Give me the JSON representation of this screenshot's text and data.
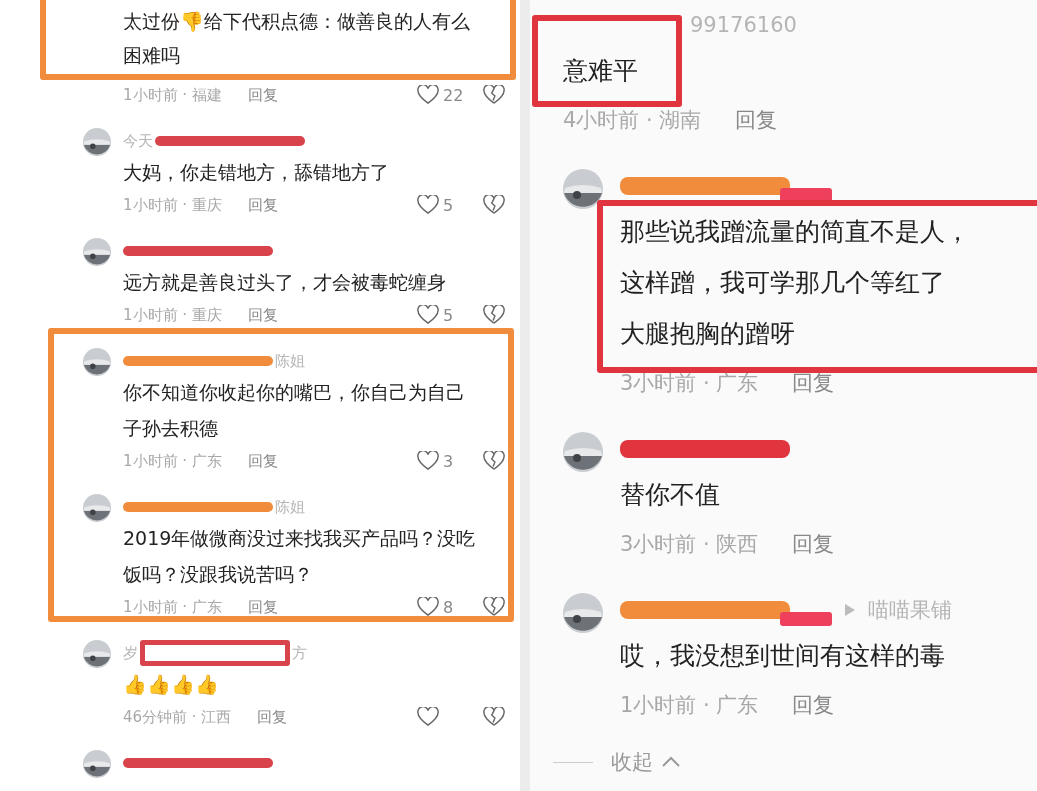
{
  "left": {
    "comments": [
      {
        "avatar": false,
        "lines": [
          "太过份👎给下代积点德：做善良的人有么",
          "困难吗"
        ],
        "time": "1小时前 · 福建",
        "reply": "回复",
        "likes": "22"
      },
      {
        "name_parts": [
          {
            "kind": "text",
            "text": "今天"
          },
          {
            "kind": "bar",
            "color": "#d9434c"
          }
        ],
        "avatar": true,
        "lines": [
          "大妈，你走错地方，舔错地方了"
        ],
        "time": "1小时前 · 重庆",
        "reply": "回复",
        "likes": "5"
      },
      {
        "name_parts": [
          {
            "kind": "bar",
            "color": "#d9434c"
          }
        ],
        "avatar": true,
        "lines": [
          "远方就是善良过头了，才会被毒蛇缠身"
        ],
        "time": "1小时前 · 重庆",
        "reply": "回复",
        "likes": "5"
      },
      {
        "name_parts": [
          {
            "kind": "bar",
            "color": "#f08c3c"
          },
          {
            "kind": "text",
            "text": "陈姐"
          }
        ],
        "avatar": true,
        "lines": [
          "你不知道你收起你的嘴巴，你自己为自己",
          "子孙去积德"
        ],
        "time": "1小时前 · 广东",
        "reply": "回复",
        "likes": "3"
      },
      {
        "name_parts": [
          {
            "kind": "bar",
            "color": "#f08c3c"
          },
          {
            "kind": "text",
            "text": "陈姐"
          }
        ],
        "avatar": true,
        "lines": [
          "2019年做微商没过来找我买产品吗？没吃",
          "饭吗？没跟我说苦吗？"
        ],
        "time": "1小时前 · 广东",
        "reply": "回复",
        "likes": "8"
      },
      {
        "name_parts": [
          {
            "kind": "text",
            "text": "岁"
          },
          {
            "kind": "outlined",
            "color": "#d9434c"
          },
          {
            "kind": "text",
            "text": "方"
          }
        ],
        "avatar": true,
        "lines": [
          "👍👍👍👍"
        ],
        "time": "46分钟前 · 江西",
        "reply": "回复"
      },
      {
        "name_parts": [
          {
            "kind": "bar",
            "color": "#d9434c"
          }
        ],
        "avatar": true
      }
    ],
    "annotations": [
      {
        "color": "#f08c3c"
      },
      {
        "color": "#f08c3c"
      }
    ]
  },
  "right": {
    "comments": [
      {
        "name_parts": [
          {
            "kind": "gap"
          },
          {
            "kind": "text",
            "text": "99176160"
          }
        ],
        "avatar": false,
        "lines": [
          "意难平"
        ],
        "time": "4小时前 · 湖南",
        "reply": "回复"
      },
      {
        "name_parts": [
          {
            "kind": "bar",
            "color": "#f08c3c"
          },
          {
            "kind": "badge",
            "color": "#ee3f5c"
          }
        ],
        "avatar": true,
        "lines": [
          "那些说我蹭流量的简直不是人，",
          "这样蹭，我可学那几个等红了",
          "大腿抱胸的蹭呀"
        ],
        "time": "3小时前 · 广东",
        "reply": "回复"
      },
      {
        "name_parts": [
          {
            "kind": "bar",
            "color": "#e0343f"
          }
        ],
        "avatar": true,
        "lines": [
          "替你不值"
        ],
        "time": "3小时前 · 陕西",
        "reply": "回复"
      },
      {
        "name_parts": [
          {
            "kind": "bar",
            "color": "#f08c3c"
          },
          {
            "kind": "badge",
            "color": "#ee3f5c"
          },
          {
            "kind": "arrow"
          },
          {
            "kind": "text",
            "text": "喵喵果铺"
          }
        ],
        "avatar": true,
        "lines": [
          "哎，我没想到世间有这样的毒"
        ],
        "time": "1小时前 · 广东",
        "reply": "回复"
      }
    ],
    "collapse": {
      "label": "收起"
    },
    "annotations": [
      {
        "color": "#e0343f"
      },
      {
        "color": "#e0343f"
      }
    ]
  }
}
